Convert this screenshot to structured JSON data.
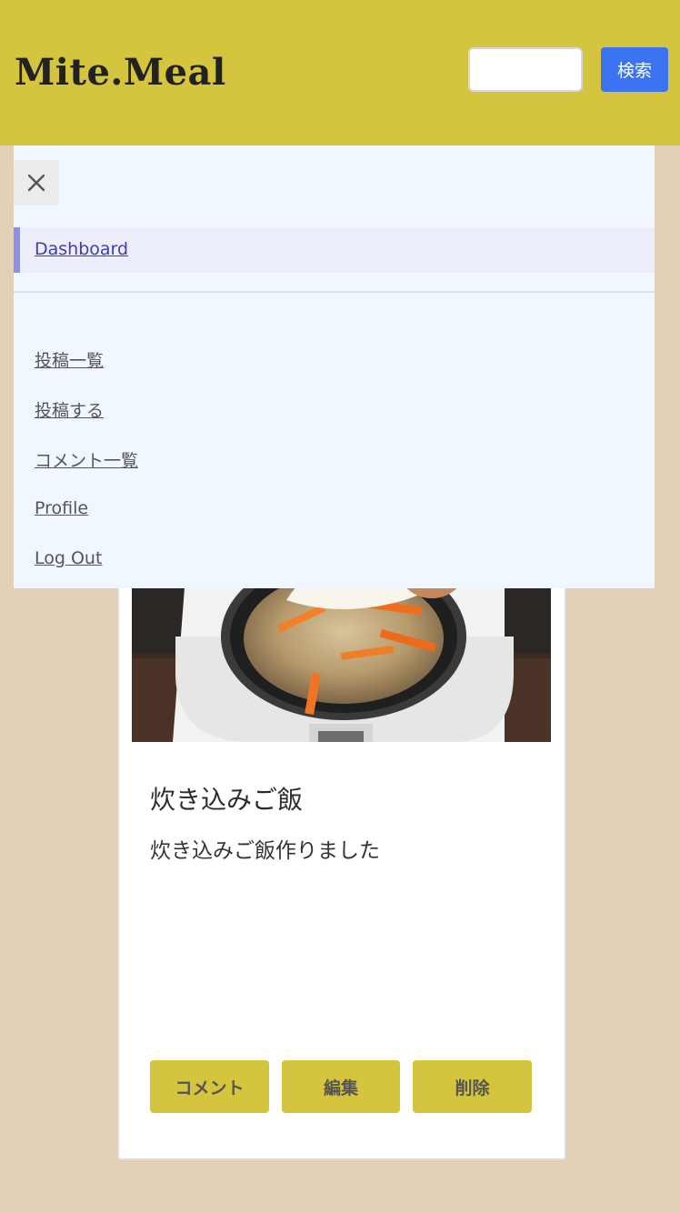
{
  "header": {
    "logo": "Mite.Meal",
    "search_placeholder": "",
    "search_button": "検索",
    "background": "#d5c43d"
  },
  "post": {
    "title": "炊き込みご飯",
    "body": "炊き込みご飯作りました",
    "buttons": {
      "comment": "コメント",
      "edit": "編集",
      "delete": "削除"
    }
  },
  "drawer": {
    "close_icon": "close-icon",
    "active_item": "Dashboard",
    "links": {
      "posts": "投稿一覧",
      "new_post": "投稿する",
      "comments": "コメント一覧",
      "profile": "Profile",
      "logout": "Log Out"
    }
  }
}
